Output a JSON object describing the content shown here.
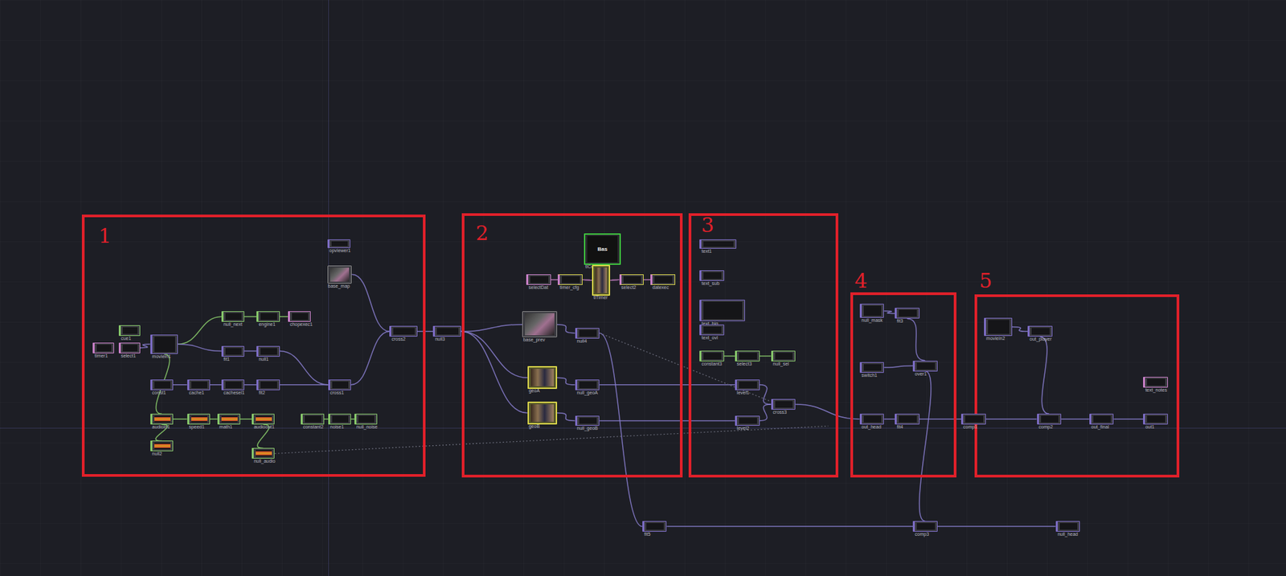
{
  "annotations": [
    {
      "label": "1"
    },
    {
      "label": "2"
    },
    {
      "label": "3"
    },
    {
      "label": "4"
    },
    {
      "label": "5"
    }
  ],
  "nodes": [
    {
      "name": "timer1",
      "kind": "dat"
    },
    {
      "name": "select1",
      "kind": "dat"
    },
    {
      "name": "cue1",
      "kind": "chop"
    },
    {
      "name": "moviein1",
      "kind": "top"
    },
    {
      "name": "null_next",
      "kind": "chop"
    },
    {
      "name": "engine1",
      "kind": "chop"
    },
    {
      "name": "chopexec1",
      "kind": "dat"
    },
    {
      "name": "fit1",
      "kind": "top"
    },
    {
      "name": "null1",
      "kind": "top"
    },
    {
      "name": "const1",
      "kind": "top"
    },
    {
      "name": "cache1",
      "kind": "top"
    },
    {
      "name": "cachesel1",
      "kind": "top"
    },
    {
      "name": "fit2",
      "kind": "top"
    },
    {
      "name": "cross1",
      "kind": "top"
    },
    {
      "name": "audioin1",
      "kind": "audio"
    },
    {
      "name": "speed1",
      "kind": "audio"
    },
    {
      "name": "math1",
      "kind": "audio"
    },
    {
      "name": "audioout1",
      "kind": "audio"
    },
    {
      "name": "null2",
      "kind": "audio"
    },
    {
      "name": "null_audio",
      "kind": "audio"
    },
    {
      "name": "constant2",
      "kind": "chop"
    },
    {
      "name": "noise1",
      "kind": "chop"
    },
    {
      "name": "null_noise",
      "kind": "chop"
    },
    {
      "name": "opviewer1",
      "kind": "top"
    },
    {
      "name": "base_map",
      "kind": "image"
    },
    {
      "name": "cross2",
      "kind": "top"
    },
    {
      "name": "null3",
      "kind": "top"
    },
    {
      "name": "selectDat",
      "kind": "dat"
    },
    {
      "name": "timer_cfg",
      "kind": "datsel"
    },
    {
      "name": "tlConfig",
      "kind": "base",
      "preview": "Bas"
    },
    {
      "name": "tlTimer",
      "kind": "comp"
    },
    {
      "name": "select2",
      "kind": "datsel"
    },
    {
      "name": "datexec",
      "kind": "datsel"
    },
    {
      "name": "base_prev",
      "kind": "image"
    },
    {
      "name": "null4",
      "kind": "top"
    },
    {
      "name": "geoA",
      "kind": "comp"
    },
    {
      "name": "geoB",
      "kind": "comp"
    },
    {
      "name": "null_geoA",
      "kind": "top"
    },
    {
      "name": "null_geoB",
      "kind": "top"
    },
    {
      "name": "text1",
      "kind": "top"
    },
    {
      "name": "text_sub",
      "kind": "top"
    },
    {
      "name": "text_big",
      "kind": "top"
    },
    {
      "name": "text_ovl",
      "kind": "top"
    },
    {
      "name": "constant3",
      "kind": "chop"
    },
    {
      "name": "select3",
      "kind": "chop"
    },
    {
      "name": "null_sel",
      "kind": "chop"
    },
    {
      "name": "level1",
      "kind": "top"
    },
    {
      "name": "level2",
      "kind": "top"
    },
    {
      "name": "cross3",
      "kind": "top"
    },
    {
      "name": "null_mask",
      "kind": "top"
    },
    {
      "name": "fit3",
      "kind": "top"
    },
    {
      "name": "switch1",
      "kind": "top"
    },
    {
      "name": "over1",
      "kind": "top"
    },
    {
      "name": "out_head",
      "kind": "top"
    },
    {
      "name": "fit4",
      "kind": "top"
    },
    {
      "name": "comp1",
      "kind": "top"
    },
    {
      "name": "moviein2",
      "kind": "top"
    },
    {
      "name": "out_player",
      "kind": "top"
    },
    {
      "name": "text_notes",
      "kind": "dat"
    },
    {
      "name": "comp2",
      "kind": "top"
    },
    {
      "name": "out_final",
      "kind": "top"
    },
    {
      "name": "out1",
      "kind": "top"
    },
    {
      "name": "fit5",
      "kind": "top"
    },
    {
      "name": "comp3",
      "kind": "top"
    },
    {
      "name": "null_head",
      "kind": "top"
    }
  ]
}
